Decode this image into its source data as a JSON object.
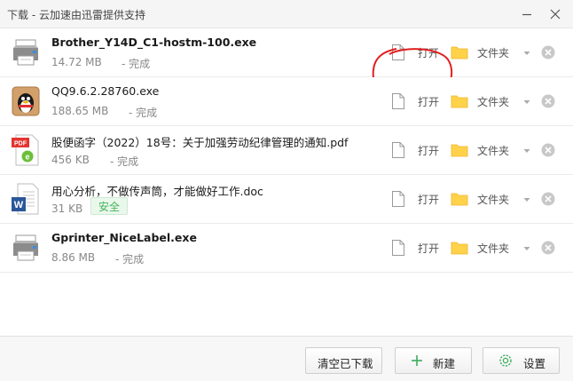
{
  "window": {
    "title": "下载 - 云加速由迅雷提供支持"
  },
  "actions": {
    "open_label": "打开",
    "folder_label": "文件夹"
  },
  "downloads": [
    {
      "name": "Brother_Y14D_C1-hostm-100.exe",
      "size": "14.72 MB",
      "status": "- 完成",
      "icon": "printer-icon"
    },
    {
      "name": "QQ9.6.2.28760.exe",
      "size": "188.65 MB",
      "status": "- 完成",
      "icon": "qq-penguin-icon"
    },
    {
      "name": "股便函字（2022）18号：关于加强劳动纪律管理的通知.pdf",
      "size": "456 KB",
      "status": "- 完成",
      "icon": "pdf-icon"
    },
    {
      "name": "用心分析，不做传声筒，才能做好工作.doc",
      "size": "31 KB",
      "badge": "安全",
      "icon": "word-doc-icon"
    },
    {
      "name": "Gprinter_NiceLabel.exe",
      "size": "8.86 MB",
      "status": "- 完成",
      "icon": "printer-icon"
    }
  ],
  "footer": {
    "clear_label": "清空已下载",
    "new_label": "新建",
    "settings_label": "设置"
  },
  "colors": {
    "folder": "#ffd24a",
    "annotation": "#e02020",
    "safe_text": "#45b35a",
    "new_plus": "#3cae5c",
    "settings_gear": "#3cae5c"
  }
}
